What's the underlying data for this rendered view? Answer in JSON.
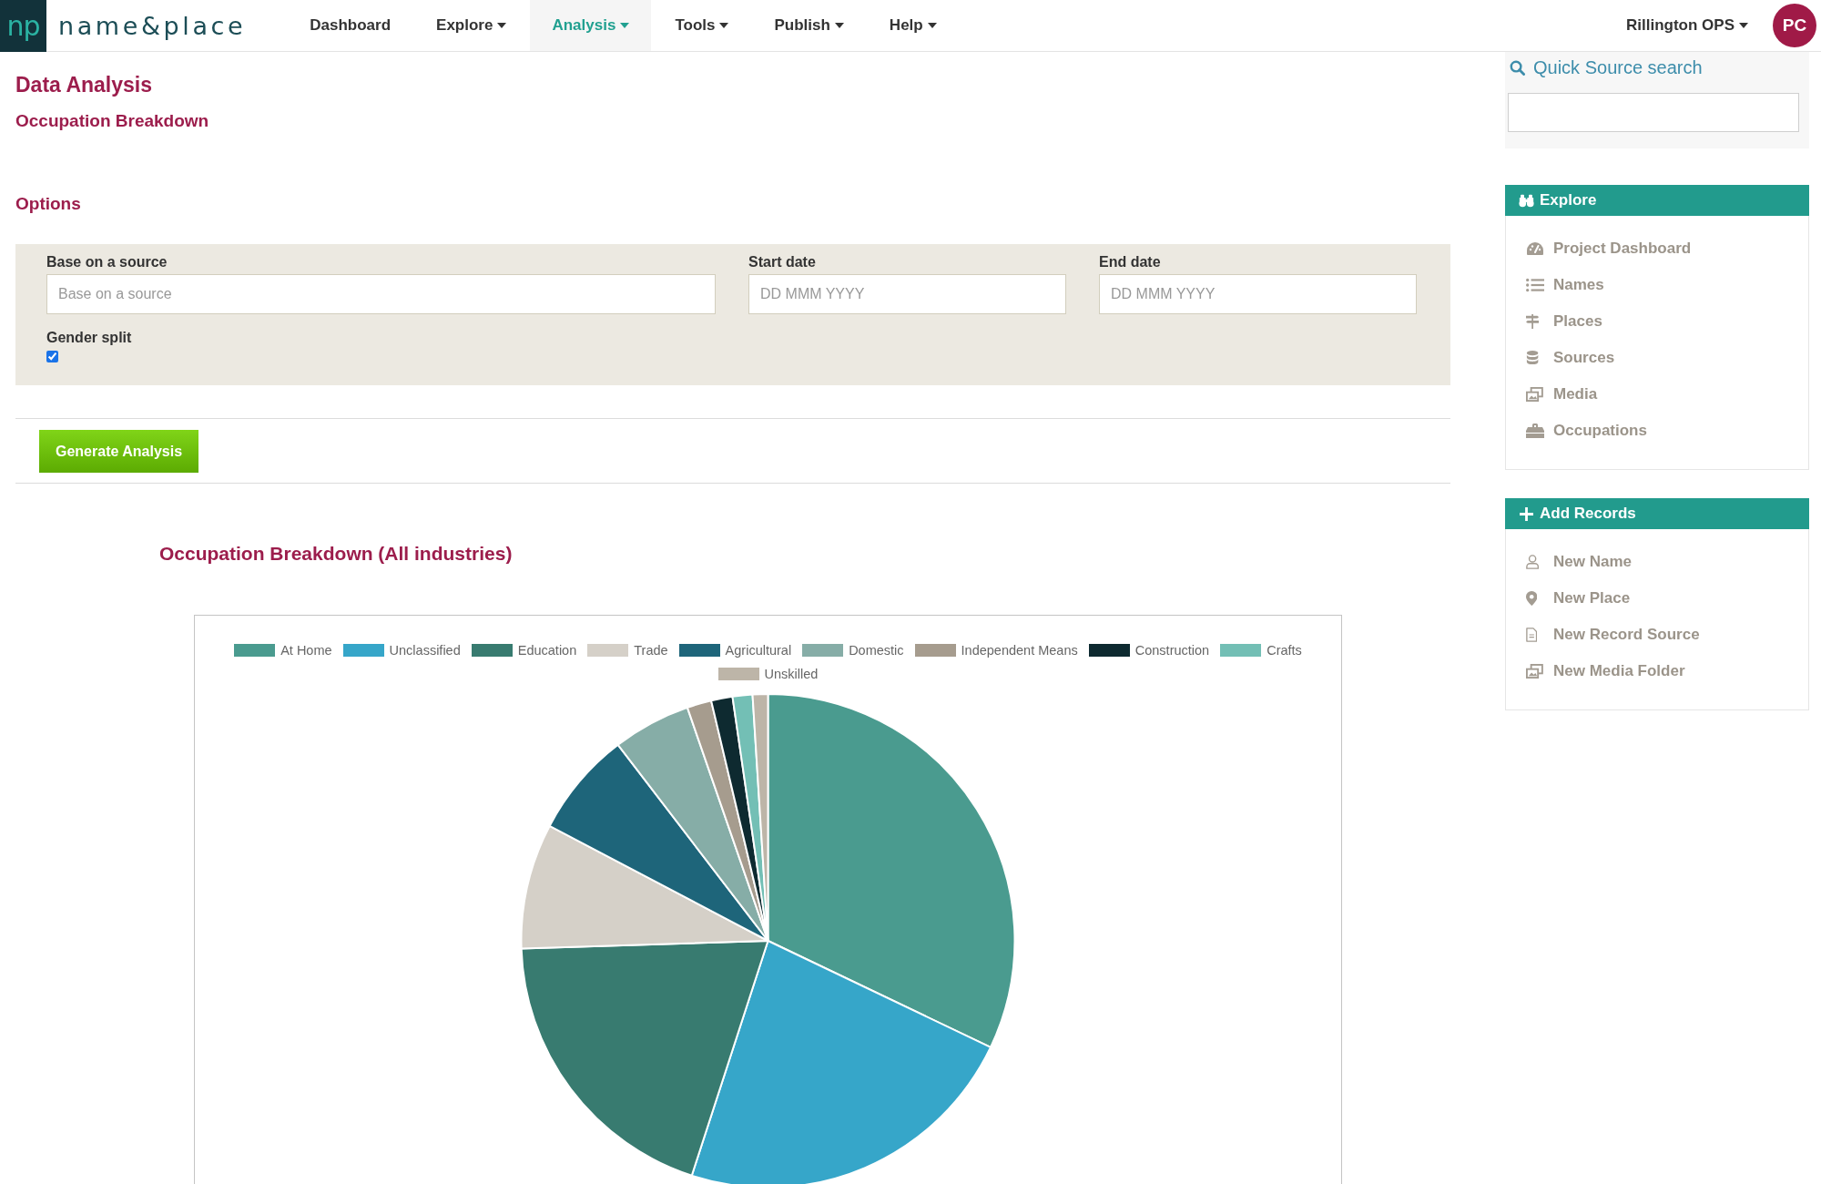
{
  "navbar": {
    "logo_mark": "np",
    "wordmark": "name&place",
    "items": [
      {
        "label": "Dashboard",
        "dropdown": false,
        "selected": false
      },
      {
        "label": "Explore",
        "dropdown": true,
        "selected": false
      },
      {
        "label": "Analysis",
        "dropdown": true,
        "selected": true
      },
      {
        "label": "Tools",
        "dropdown": true,
        "selected": false
      },
      {
        "label": "Publish",
        "dropdown": true,
        "selected": false
      },
      {
        "label": "Help",
        "dropdown": true,
        "selected": false
      }
    ],
    "account": {
      "label": "Rillington OPS",
      "dropdown": true
    },
    "avatar": "PC"
  },
  "page": {
    "title": "Data Analysis",
    "subtitle": "Occupation Breakdown"
  },
  "options": {
    "heading": "Options",
    "fields": [
      {
        "label": "Base on a source",
        "placeholder": "Base on a source"
      },
      {
        "label": "Start date",
        "placeholder": "DD MMM YYYY"
      },
      {
        "label": "End date",
        "placeholder": "DD MMM YYYY"
      }
    ],
    "gender_split": {
      "label": "Gender split",
      "checked": true
    },
    "generate_button": "Generate Analysis"
  },
  "chart": {
    "chart_data": {
      "type": "pie",
      "title": "Occupation Breakdown (All industries)",
      "legend": "top",
      "categories": [
        "At Home",
        "Unclassified",
        "Education",
        "Trade",
        "Agricultural",
        "Domestic",
        "Independent Means",
        "Construction",
        "Crafts",
        "Unskilled"
      ],
      "values": [
        32.1,
        22.9,
        19.5,
        8.2,
        6.9,
        5.1,
        1.6,
        1.4,
        1.3,
        1.0
      ],
      "colors": [
        "#4a9b8f",
        "#36a6c9",
        "#387b70",
        "#d5d0c8",
        "#1e657a",
        "#86ada7",
        "#a69c8e",
        "#0e2a30",
        "#73bfb5",
        "#bdb5a8"
      ]
    }
  },
  "sidebar": {
    "quick_search": {
      "label": "Quick Source search"
    },
    "panels": [
      {
        "title": "Explore",
        "items": [
          "Project Dashboard",
          "Names",
          "Places",
          "Sources",
          "Media",
          "Occupations"
        ]
      },
      {
        "title": "Add Records",
        "items": [
          "New Name",
          "New Place",
          "New Record Source",
          "New Media Folder"
        ]
      }
    ]
  }
}
